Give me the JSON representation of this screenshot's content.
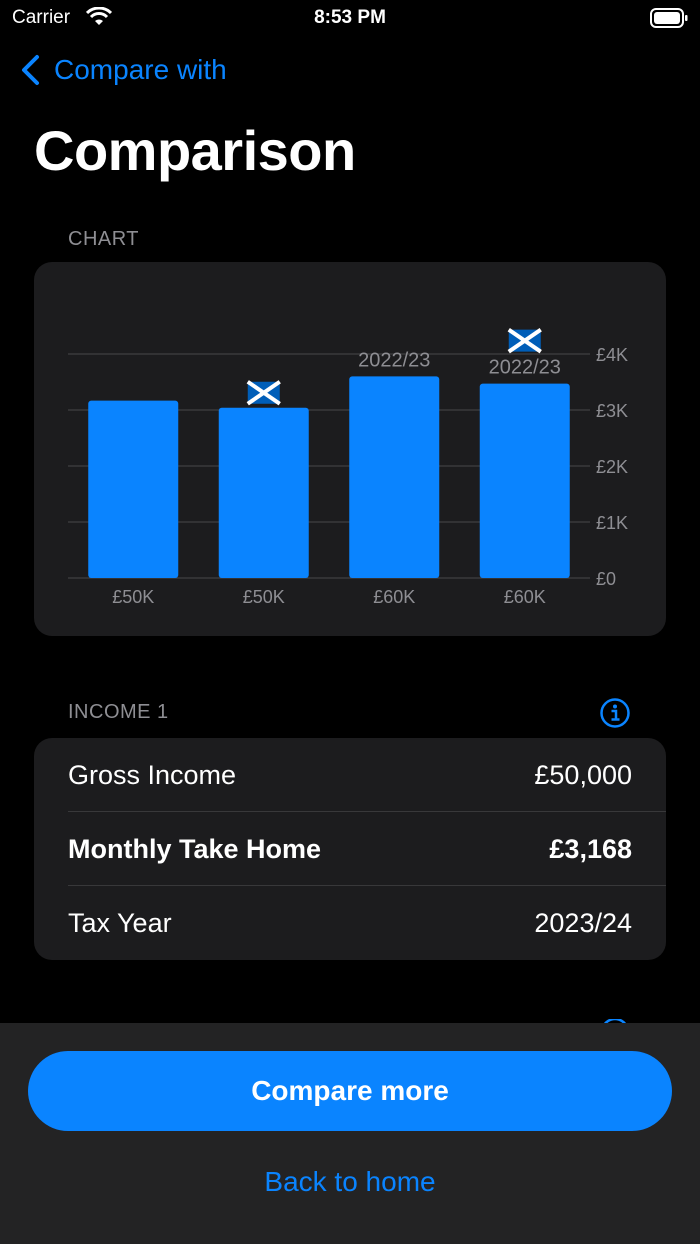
{
  "status_bar": {
    "carrier": "Carrier",
    "time": "8:53 PM"
  },
  "nav": {
    "back_label": "Compare with"
  },
  "page": {
    "title": "Comparison"
  },
  "sections": {
    "chart_header": "CHART",
    "income_header": "INCOME 1"
  },
  "chart_data": {
    "type": "bar",
    "categories": [
      "£50K",
      "£50K",
      "£60K",
      "£60K"
    ],
    "values": [
      3168,
      3040,
      3600,
      3470
    ],
    "bar_annotations": [
      {
        "flag": false,
        "label": ""
      },
      {
        "flag": true,
        "label": ""
      },
      {
        "flag": false,
        "label": "2022/23"
      },
      {
        "flag": true,
        "label": "2022/23"
      }
    ],
    "y_ticks": [
      0,
      1000,
      2000,
      3000,
      4000
    ],
    "y_tick_labels": [
      "£0",
      "£1K",
      "£2K",
      "£3K",
      "£4K"
    ],
    "ylim": [
      0,
      4000
    ],
    "grid": true,
    "y_axis_position": "right",
    "bar_color": "#0a84ff",
    "title": "",
    "xlabel": "",
    "ylabel": ""
  },
  "income": {
    "rows": [
      {
        "label": "Gross Income",
        "value": "£50,000"
      },
      {
        "label": "Monthly Take Home",
        "value": "£3,168"
      },
      {
        "label": "Tax Year",
        "value": "2023/24"
      }
    ]
  },
  "actions": {
    "compare_more": "Compare more",
    "back_home": "Back to home"
  },
  "icons": {
    "back": "chevron-left-icon",
    "info": "info-circle-icon",
    "flag": "scotland-flag-icon"
  },
  "colors": {
    "accent": "#0a84ff",
    "card": "#1c1c1e",
    "bottom_panel": "#232324",
    "secondary_text": "#8e8e93"
  }
}
